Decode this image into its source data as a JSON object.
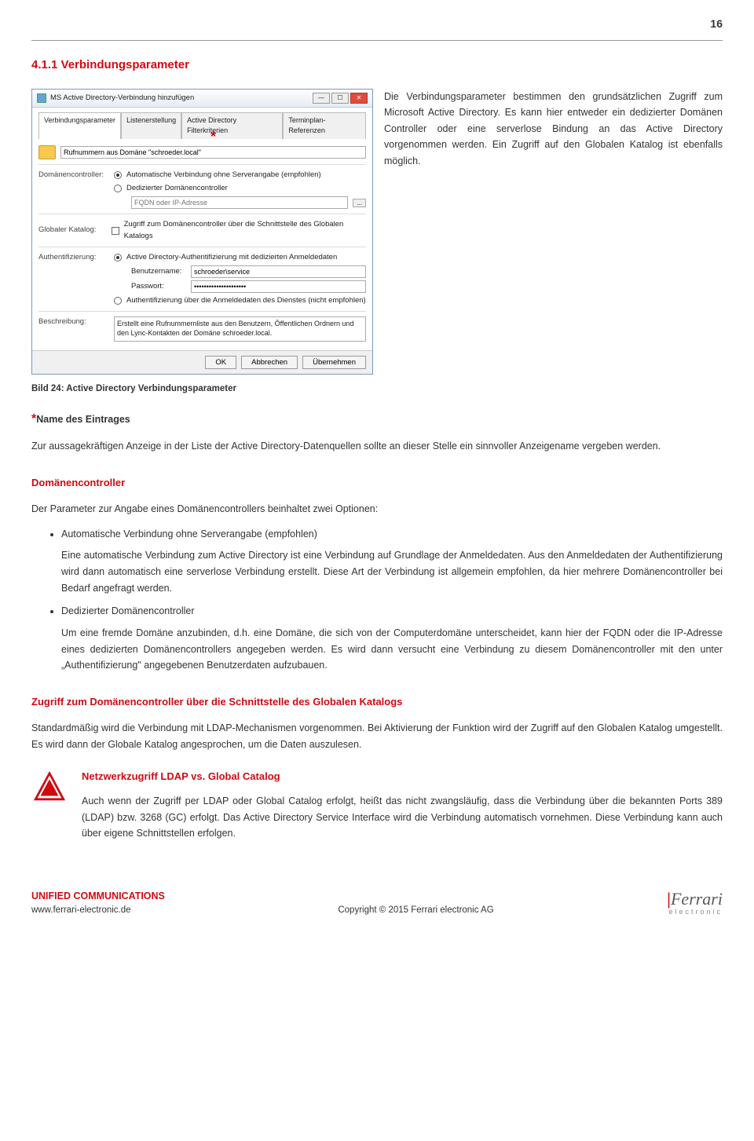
{
  "page_number": "16",
  "section": {
    "title": "4.1.1 Verbindungsparameter"
  },
  "intro": "Die Verbindungsparameter bestimmen den grundsätzlichen Zugriff zum Microsoft Active Directory. Es kann hier entweder ein dedizierter Domänen Controller oder eine serverlose Bindung an das Active Directory vorgenommen werden. Ein Zugriff auf den Globalen Katalog ist ebenfalls möglich.",
  "dialog": {
    "title": "MS Active Directory-Verbindung hinzufügen",
    "tabs": [
      "Verbindungsparameter",
      "Listenerstellung",
      "Active Directory Filterkriterien",
      "Terminplan-Referenzen"
    ],
    "name_field": "Rufnummern aus Domäne \"schroeder.local\"",
    "dc_label": "Domänencontroller:",
    "dc_opt1": "Automatische Verbindung ohne Serverangabe (empfohlen)",
    "dc_opt2": "Dedizierter Domänencontroller",
    "dc_placeholder": "FQDN oder IP-Adresse",
    "gk_label": "Globaler Katalog:",
    "gk_opt": "Zugriff zum Domänencontroller über die Schnittstelle des Globalen Katalogs",
    "auth_label": "Authentifizierung:",
    "auth_opt1": "Active Directory-Authentifizierung mit dedizierten Anmeldedaten",
    "user_label": "Benutzername:",
    "user_value": "schroeder\\service",
    "pass_label": "Passwort:",
    "pass_value": "•••••••••••••••••••••",
    "auth_opt2": "Authentifizierung über die Anmeldedaten des Dienstes (nicht empfohlen)",
    "desc_label": "Beschreibung:",
    "desc_value": "Erstellt eine Rufnummernliste aus den Benutzern, Öffentlichen Ordnern und den Lync-Kontakten der Domäne schroeder.local.",
    "buttons": {
      "ok": "OK",
      "cancel": "Abbrechen",
      "apply": "Übernehmen"
    }
  },
  "caption": "Bild 24: Active Directory Verbindungsparameter",
  "name_entry": {
    "heading": "Name des Eintrages",
    "text": "Zur aussagekräftigen Anzeige in der Liste der Active Directory-Datenquellen sollte an dieser Stelle ein sinnvoller Anzeigename vergeben werden."
  },
  "dc_section": {
    "heading": "Domänencontroller",
    "lead": "Der Parameter zur Angabe eines Domänencontrollers beinhaltet zwei Optionen:",
    "item1_title": "Automatische Verbindung ohne Serverangabe (empfohlen)",
    "item1_text": "Eine automatische Verbindung zum Active Directory ist eine Verbindung auf Grundlage der Anmeldedaten. Aus den Anmeldedaten der Authentifizierung wird dann automatisch eine serverlose Verbindung erstellt. Diese Art der Verbindung ist allgemein empfohlen, da hier mehrere Domänencontroller bei Bedarf angefragt werden.",
    "item2_title": "Dedizierter Domänencontroller",
    "item2_text": "Um eine fremde Domäne anzubinden, d.h. eine Domäne, die sich von der Computerdomäne unterscheidet, kann hier der FQDN oder die IP-Adresse eines dedizierten Domänencontrollers angegeben werden. Es wird dann versucht eine Verbindung zu diesem Domänencontroller mit den unter „Authentifizierung\" angegebenen Benutzerdaten aufzubauen."
  },
  "gk_section": {
    "heading": "Zugriff zum Domänencontroller über die Schnittstelle des Globalen Katalogs",
    "text": "Standardmäßig wird die Verbindung mit LDAP-Mechanismen vorgenommen. Bei Aktivierung der Funktion wird der Zugriff auf den Globalen Katalog umgestellt. Es wird dann der Globale Katalog angesprochen, um die Daten auszulesen."
  },
  "note": {
    "heading": "Netzwerkzugriff LDAP vs. Global Catalog",
    "text": "Auch wenn der Zugriff per LDAP oder Global Catalog erfolgt, heißt das nicht zwangsläufig, dass die Verbindung über die bekannten Ports 389 (LDAP) bzw. 3268 (GC) erfolgt. Das Active Directory Service Interface wird die Verbindung automatisch vornehmen. Diese Verbindung kann auch über eigene Schnittstellen erfolgen."
  },
  "footer": {
    "uc": "UNIFIED COMMUNICATIONS",
    "url": "www.ferrari-electronic.de",
    "copyright": "Copyright © 2015 Ferrari electronic AG",
    "logo_main": "Ferrari",
    "logo_sub": "electronic"
  }
}
